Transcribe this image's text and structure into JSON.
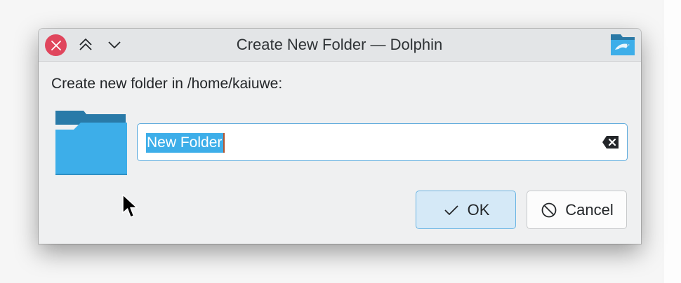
{
  "window": {
    "title": "Create New Folder — Dolphin",
    "close_icon": "close-icon",
    "keep_above_icon": "double-chevron-up-icon",
    "shade_icon": "chevron-down-icon",
    "app_icon": "dolphin-folder-icon"
  },
  "dialog": {
    "prompt": "Create new folder in /home/kaiuwe:",
    "folder_icon": "folder-icon",
    "name_field": {
      "value": "New Folder",
      "selected": true,
      "clear_icon": "clear-text-icon"
    },
    "buttons": {
      "ok_label": "OK",
      "ok_icon": "checkmark-icon",
      "cancel_label": "Cancel",
      "cancel_icon": "cancel-icon"
    }
  },
  "colors": {
    "accent": "#3daee9",
    "close_button": "#e0465d",
    "folder_front": "#3daee9",
    "folder_back": "#297aa8",
    "ok_button_bg": "#d5e9f7",
    "dialog_bg": "#eff0f1"
  }
}
